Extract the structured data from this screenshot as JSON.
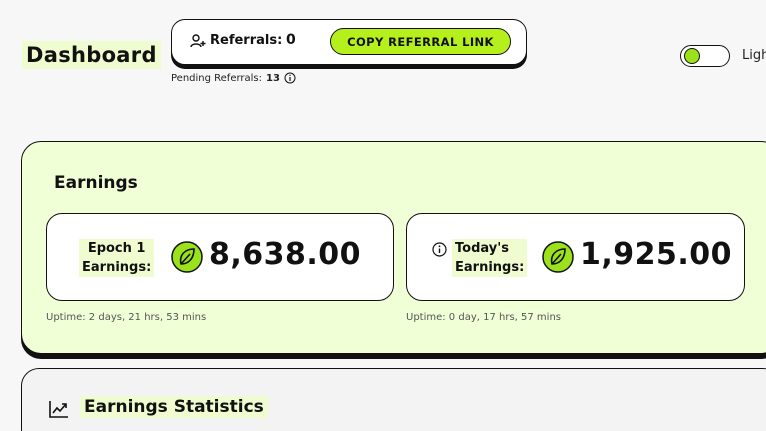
{
  "page": {
    "title": "Dashboard"
  },
  "referrals": {
    "label": "Referrals:",
    "count": "0",
    "copy_button": "COPY REFERRAL LINK",
    "pending_label": "Pending Referrals:",
    "pending_count": "13"
  },
  "theme_toggle": {
    "label": "Ligh",
    "state": "on"
  },
  "earnings": {
    "title": "Earnings",
    "epoch": {
      "label_line1": "Epoch 1",
      "label_line2": "Earnings:",
      "amount": "8,638.00",
      "uptime": "Uptime: 2 days, 21 hrs, 53 mins"
    },
    "today": {
      "label_line1": "Today's",
      "label_line2": "Earnings:",
      "amount": "1,925.00",
      "uptime": "Uptime: 0 day, 17 hrs, 57 mins"
    }
  },
  "stats": {
    "title": "Earnings Statistics"
  },
  "colors": {
    "accent": "#b6f01c",
    "card_background": "#f1ffd6",
    "label_highlight": "#eefcd0",
    "border": "#111111"
  },
  "icons": {
    "referral": "user-plus-icon",
    "info": "info-icon",
    "token": "leaf-token-icon",
    "stats": "trending-up-icon"
  }
}
